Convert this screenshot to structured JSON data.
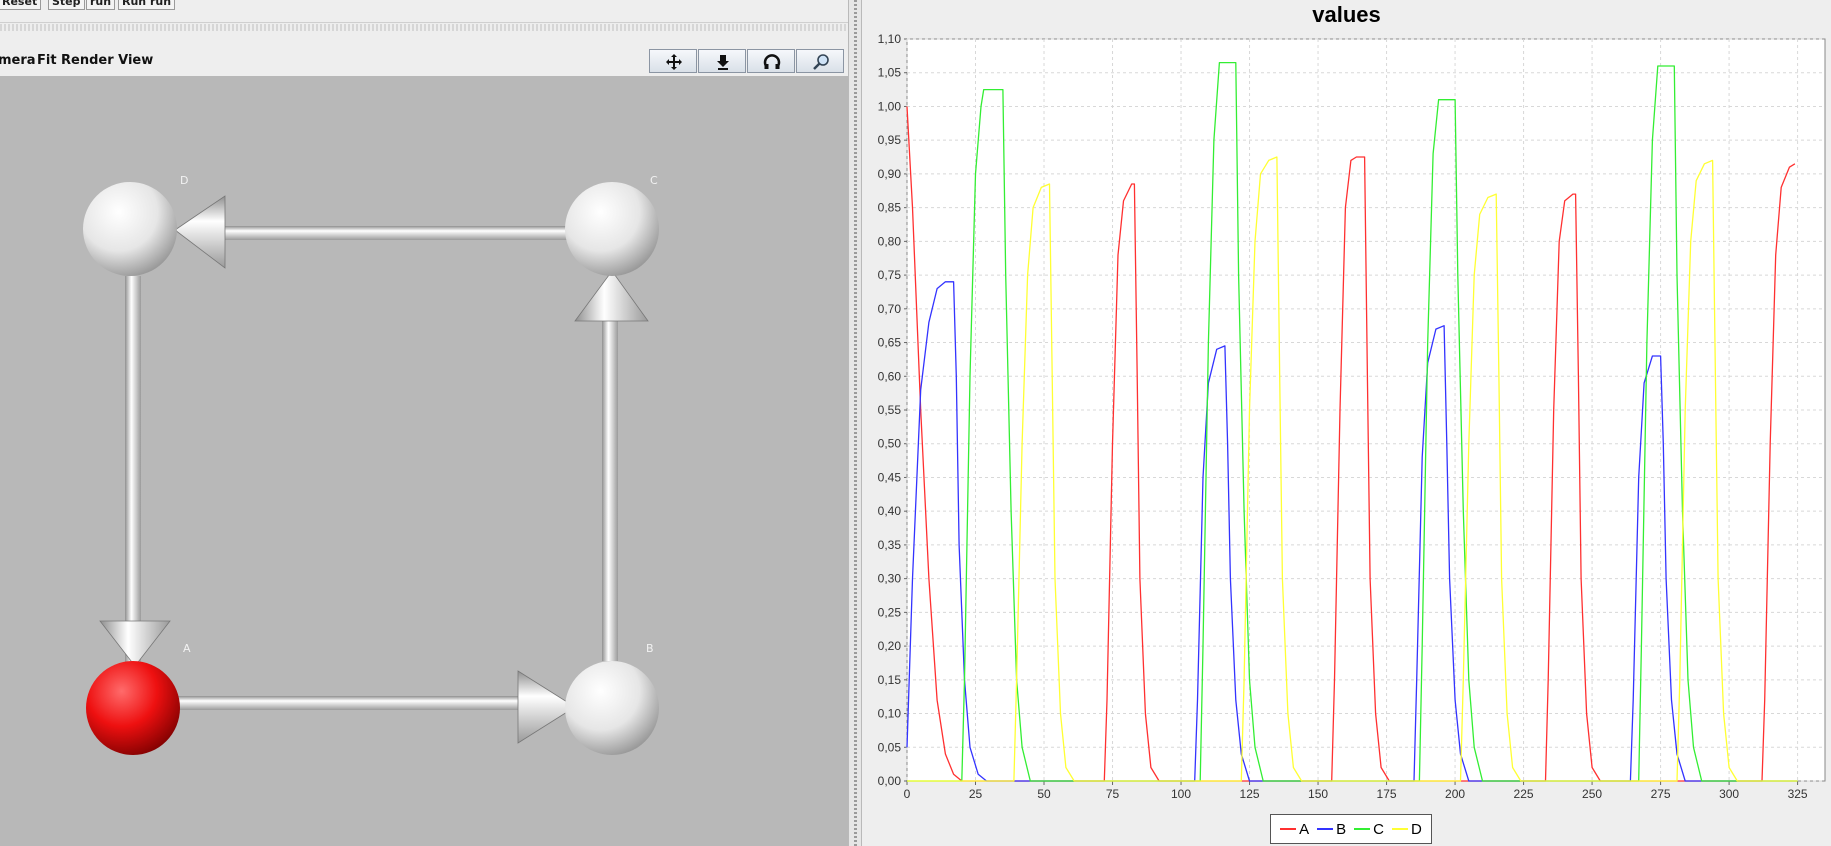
{
  "top_toolbar": {
    "buttons": [
      "Reset",
      "Step",
      "run",
      "Run run"
    ]
  },
  "view_menu": {
    "items": [
      "mera",
      "Fit",
      "Render View"
    ]
  },
  "view_tools": [
    "move-icon",
    "pin-icon",
    "rotate-icon",
    "zoom-icon"
  ],
  "graph": {
    "nodes": [
      {
        "id": "D",
        "label": "D",
        "color": "#f2f2f2"
      },
      {
        "id": "C",
        "label": "C",
        "color": "#f2f2f2"
      },
      {
        "id": "A",
        "label": "A",
        "color": "#e01010"
      },
      {
        "id": "B",
        "label": "B",
        "color": "#f2f2f2"
      }
    ],
    "edges": [
      {
        "from": "C",
        "to": "D"
      },
      {
        "from": "D",
        "to": "A"
      },
      {
        "from": "A",
        "to": "B"
      },
      {
        "from": "B",
        "to": "C"
      }
    ]
  },
  "chart_data": {
    "type": "line",
    "title": "values",
    "xlabel": "",
    "ylabel": "",
    "xlim": [
      0,
      335
    ],
    "ylim": [
      0,
      1.1
    ],
    "xticks": [
      "0",
      "25",
      "50",
      "75",
      "100",
      "125",
      "150",
      "175",
      "200",
      "225",
      "250",
      "275",
      "300",
      "325"
    ],
    "yticks": [
      "0,00",
      "0,05",
      "0,10",
      "0,15",
      "0,20",
      "0,25",
      "0,30",
      "0,35",
      "0,40",
      "0,45",
      "0,50",
      "0,55",
      "0,60",
      "0,65",
      "0,70",
      "0,75",
      "0,80",
      "0,85",
      "0,90",
      "0,95",
      "1,00",
      "1,05",
      "1,10"
    ],
    "grid": true,
    "legend_position": "bottom",
    "series": [
      {
        "name": "A",
        "color": "#ff3030",
        "points": [
          [
            0,
            1.0
          ],
          [
            2,
            0.85
          ],
          [
            5,
            0.55
          ],
          [
            8,
            0.3
          ],
          [
            11,
            0.12
          ],
          [
            14,
            0.04
          ],
          [
            17,
            0.01
          ],
          [
            20,
            0
          ],
          [
            72,
            0
          ],
          [
            73,
            0.12
          ],
          [
            75,
            0.5
          ],
          [
            77,
            0.78
          ],
          [
            79,
            0.86
          ],
          [
            82,
            0.885
          ],
          [
            83,
            0.885
          ],
          [
            84,
            0.6
          ],
          [
            85,
            0.3
          ],
          [
            87,
            0.1
          ],
          [
            89,
            0.02
          ],
          [
            92,
            0
          ],
          [
            155,
            0
          ],
          [
            156,
            0.15
          ],
          [
            158,
            0.55
          ],
          [
            160,
            0.85
          ],
          [
            162,
            0.92
          ],
          [
            164,
            0.925
          ],
          [
            167,
            0.925
          ],
          [
            168,
            0.6
          ],
          [
            169,
            0.3
          ],
          [
            171,
            0.1
          ],
          [
            173,
            0.02
          ],
          [
            176,
            0
          ],
          [
            233,
            0
          ],
          [
            234,
            0.15
          ],
          [
            236,
            0.55
          ],
          [
            238,
            0.8
          ],
          [
            240,
            0.86
          ],
          [
            243,
            0.87
          ],
          [
            244,
            0.87
          ],
          [
            245,
            0.6
          ],
          [
            246,
            0.3
          ],
          [
            248,
            0.1
          ],
          [
            250,
            0.02
          ],
          [
            253,
            0
          ],
          [
            312,
            0
          ],
          [
            313,
            0.12
          ],
          [
            315,
            0.5
          ],
          [
            317,
            0.78
          ],
          [
            319,
            0.88
          ],
          [
            322,
            0.91
          ],
          [
            324,
            0.915
          ]
        ]
      },
      {
        "name": "B",
        "color": "#3333ff",
        "points": [
          [
            0,
            0.05
          ],
          [
            2,
            0.3
          ],
          [
            5,
            0.58
          ],
          [
            8,
            0.68
          ],
          [
            11,
            0.73
          ],
          [
            14,
            0.74
          ],
          [
            17,
            0.74
          ],
          [
            18,
            0.6
          ],
          [
            19,
            0.35
          ],
          [
            21,
            0.15
          ],
          [
            23,
            0.05
          ],
          [
            26,
            0.01
          ],
          [
            29,
            0
          ],
          [
            105,
            0
          ],
          [
            106,
            0.12
          ],
          [
            108,
            0.45
          ],
          [
            110,
            0.59
          ],
          [
            113,
            0.64
          ],
          [
            116,
            0.645
          ],
          [
            117,
            0.5
          ],
          [
            118,
            0.3
          ],
          [
            120,
            0.12
          ],
          [
            122,
            0.04
          ],
          [
            125,
            0
          ],
          [
            185,
            0
          ],
          [
            186,
            0.15
          ],
          [
            188,
            0.48
          ],
          [
            190,
            0.62
          ],
          [
            193,
            0.67
          ],
          [
            196,
            0.675
          ],
          [
            197,
            0.5
          ],
          [
            198,
            0.3
          ],
          [
            200,
            0.12
          ],
          [
            202,
            0.04
          ],
          [
            205,
            0
          ],
          [
            264,
            0
          ],
          [
            265,
            0.12
          ],
          [
            267,
            0.45
          ],
          [
            269,
            0.59
          ],
          [
            272,
            0.63
          ],
          [
            275,
            0.63
          ],
          [
            276,
            0.5
          ],
          [
            277,
            0.3
          ],
          [
            279,
            0.12
          ],
          [
            281,
            0.04
          ],
          [
            284,
            0
          ],
          [
            325,
            0
          ]
        ]
      },
      {
        "name": "C",
        "color": "#33ee33",
        "points": [
          [
            0,
            0
          ],
          [
            20,
            0
          ],
          [
            21,
            0.15
          ],
          [
            23,
            0.6
          ],
          [
            25,
            0.9
          ],
          [
            27,
            1.0
          ],
          [
            28,
            1.025
          ],
          [
            35,
            1.025
          ],
          [
            36,
            0.75
          ],
          [
            38,
            0.4
          ],
          [
            40,
            0.15
          ],
          [
            42,
            0.05
          ],
          [
            45,
            0
          ],
          [
            107,
            0
          ],
          [
            108,
            0.2
          ],
          [
            110,
            0.65
          ],
          [
            112,
            0.95
          ],
          [
            114,
            1.065
          ],
          [
            120,
            1.065
          ],
          [
            121,
            0.75
          ],
          [
            123,
            0.4
          ],
          [
            125,
            0.15
          ],
          [
            127,
            0.05
          ],
          [
            130,
            0
          ],
          [
            187,
            0
          ],
          [
            188,
            0.2
          ],
          [
            190,
            0.65
          ],
          [
            192,
            0.93
          ],
          [
            194,
            1.01
          ],
          [
            200,
            1.01
          ],
          [
            201,
            0.75
          ],
          [
            203,
            0.4
          ],
          [
            205,
            0.15
          ],
          [
            207,
            0.05
          ],
          [
            210,
            0
          ],
          [
            267,
            0
          ],
          [
            268,
            0.2
          ],
          [
            270,
            0.65
          ],
          [
            272,
            0.95
          ],
          [
            274,
            1.06
          ],
          [
            280,
            1.06
          ],
          [
            281,
            0.75
          ],
          [
            283,
            0.4
          ],
          [
            285,
            0.15
          ],
          [
            287,
            0.05
          ],
          [
            290,
            0
          ],
          [
            325,
            0
          ]
        ]
      },
      {
        "name": "D",
        "color": "#ffff33",
        "points": [
          [
            0,
            0
          ],
          [
            39,
            0
          ],
          [
            40,
            0.15
          ],
          [
            42,
            0.5
          ],
          [
            44,
            0.75
          ],
          [
            46,
            0.85
          ],
          [
            49,
            0.88
          ],
          [
            52,
            0.885
          ],
          [
            53,
            0.6
          ],
          [
            54,
            0.3
          ],
          [
            56,
            0.1
          ],
          [
            58,
            0.02
          ],
          [
            61,
            0
          ],
          [
            122,
            0
          ],
          [
            123,
            0.15
          ],
          [
            125,
            0.55
          ],
          [
            127,
            0.8
          ],
          [
            129,
            0.9
          ],
          [
            132,
            0.92
          ],
          [
            135,
            0.925
          ],
          [
            136,
            0.6
          ],
          [
            137,
            0.3
          ],
          [
            139,
            0.1
          ],
          [
            141,
            0.02
          ],
          [
            144,
            0
          ],
          [
            202,
            0
          ],
          [
            203,
            0.15
          ],
          [
            205,
            0.5
          ],
          [
            207,
            0.75
          ],
          [
            209,
            0.84
          ],
          [
            212,
            0.865
          ],
          [
            215,
            0.87
          ],
          [
            216,
            0.6
          ],
          [
            217,
            0.3
          ],
          [
            219,
            0.1
          ],
          [
            221,
            0.02
          ],
          [
            224,
            0
          ],
          [
            281,
            0
          ],
          [
            282,
            0.15
          ],
          [
            284,
            0.55
          ],
          [
            286,
            0.8
          ],
          [
            288,
            0.89
          ],
          [
            291,
            0.915
          ],
          [
            294,
            0.92
          ],
          [
            295,
            0.6
          ],
          [
            296,
            0.3
          ],
          [
            298,
            0.1
          ],
          [
            300,
            0.02
          ],
          [
            303,
            0
          ],
          [
            325,
            0
          ]
        ]
      }
    ]
  }
}
